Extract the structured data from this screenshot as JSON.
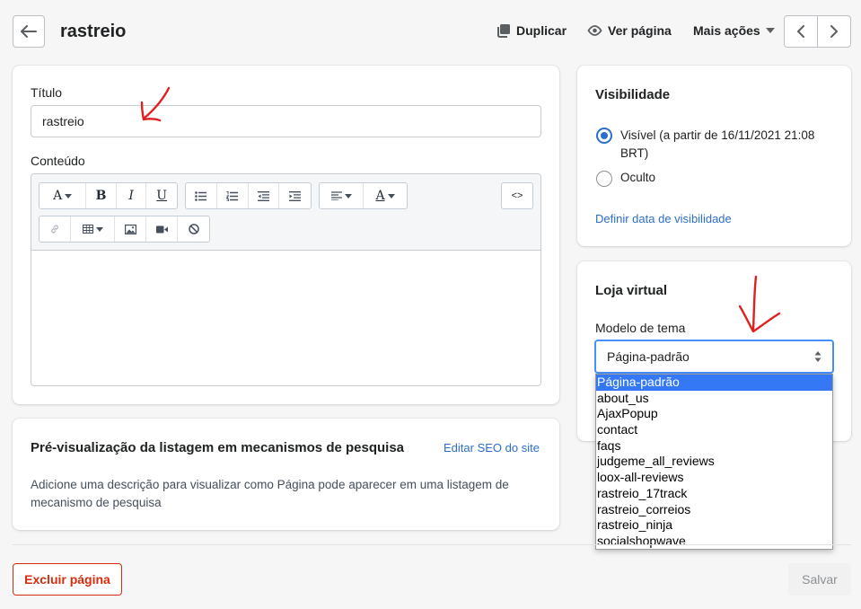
{
  "header": {
    "title": "rastreio",
    "duplicate_label": "Duplicar",
    "view_label": "Ver página",
    "more_label": "Mais ações"
  },
  "form": {
    "title_label": "Título",
    "title_value": "rastreio",
    "content_label": "Conteúdo",
    "toolbar": {
      "font_letter": "A",
      "bold": "B",
      "italic": "I",
      "underline": "U",
      "color_letter": "A",
      "code": "<>"
    }
  },
  "seo": {
    "title": "Pré-visualização da listagem em mecanismos de pesquisa",
    "edit_link": "Editar SEO do site",
    "description": "Adicione uma descrição para visualizar como Página pode aparecer em uma listagem de mecanismo de pesquisa"
  },
  "visibility": {
    "title": "Visibilidade",
    "visible_label": "Visível (a partir de 16/11/2021 21:08 BRT)",
    "hidden_label": "Oculto",
    "set_date_link": "Definir data de visibilidade",
    "selected": "visible"
  },
  "store": {
    "title": "Loja virtual",
    "template_label": "Modelo de tema",
    "template_value": "Página-padrão",
    "options": [
      "Página-padrão",
      "about_us",
      "AjaxPopup",
      "contact",
      "faqs",
      "judgeme_all_reviews",
      "loox-all-reviews",
      "rastreio_17track",
      "rastreio_correios",
      "rastreio_ninja",
      "socialshopwave"
    ]
  },
  "footer": {
    "delete_label": "Excluir página",
    "save_label": "Salvar"
  },
  "colors": {
    "accent": "#2c6ecb",
    "danger": "#d72c0d",
    "annotation": "#e02020"
  }
}
